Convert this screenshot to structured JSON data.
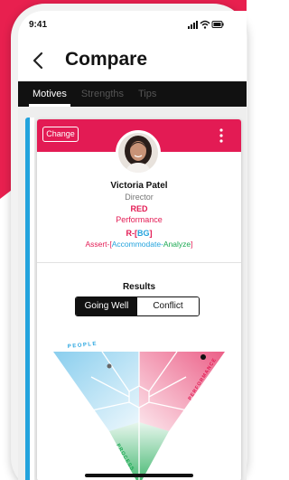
{
  "status_bar": {
    "time": "9:41",
    "icons": [
      "signal-icon",
      "wifi-icon",
      "battery-icon"
    ]
  },
  "nav": {
    "title": "Compare",
    "back_icon": "chevron-left-icon"
  },
  "tabs": [
    {
      "label": "Motives",
      "active": true
    },
    {
      "label": "Strengths",
      "active": false
    },
    {
      "label": "Tips",
      "active": false
    }
  ],
  "card": {
    "change_label": "Change",
    "more_icon": "more-vertical-icon",
    "person": {
      "name": "Victoria Patel",
      "title": "Director",
      "type_code": "RED",
      "type_name": "Performance",
      "conflict_code": {
        "prefix": "R-[",
        "middle": "BG",
        "suffix": "]"
      },
      "conflict_sequence": {
        "first": "Assert-[",
        "second": "Accommodate-",
        "third": "Analyze",
        "end": "]"
      }
    }
  },
  "results": {
    "title": "Results",
    "segments": [
      {
        "label": "Going Well",
        "active": true
      },
      {
        "label": "Conflict",
        "active": false
      }
    ],
    "triangle_labels": {
      "people": "PEOPLE",
      "performance": "PERFORMANCE",
      "process": "PROCESS"
    }
  },
  "colors": {
    "red": "#e31b54",
    "blue": "#23a3dd",
    "green": "#1aa851",
    "dark": "#111111"
  }
}
